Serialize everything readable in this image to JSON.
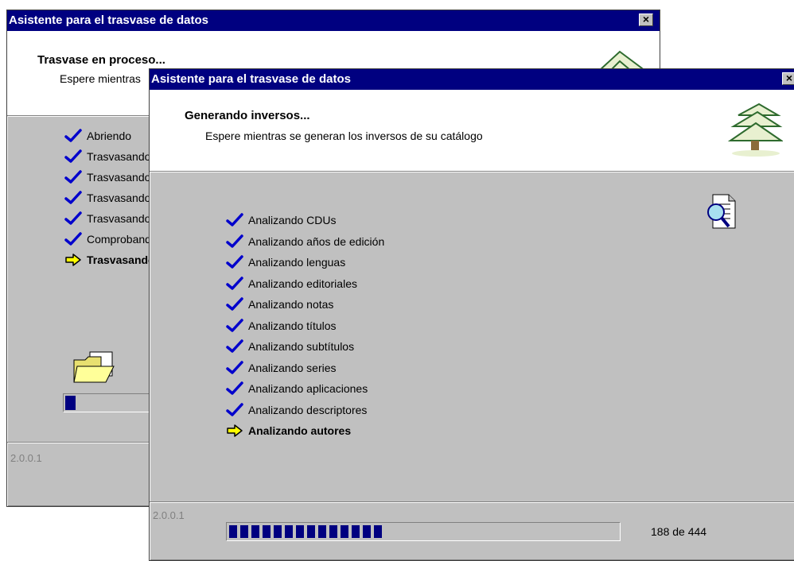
{
  "back_window": {
    "title": "Asistente para el trasvase de datos",
    "close_label": "×",
    "header_title": "Trasvase en proceso...",
    "header_subtitle": "Espere mientras",
    "steps": [
      {
        "label": "Abriendo",
        "status": "done"
      },
      {
        "label": "Trasvasando",
        "status": "done"
      },
      {
        "label": "Trasvasando",
        "status": "done"
      },
      {
        "label": "Trasvasando",
        "status": "done"
      },
      {
        "label": "Trasvasando",
        "status": "done"
      },
      {
        "label": "Comprobando",
        "status": "done"
      },
      {
        "label": "Trasvasando",
        "status": "current"
      }
    ],
    "version": "2.0.0.1",
    "progress_fraction": 0.05
  },
  "front_window": {
    "title": "Asistente para el trasvase de datos",
    "close_label": "×",
    "header_title": "Generando inversos...",
    "header_subtitle": "Espere mientras se generan los inversos de su catálogo",
    "steps": [
      {
        "label": "Analizando CDUs",
        "status": "done"
      },
      {
        "label": "Analizando años de edición",
        "status": "done"
      },
      {
        "label": "Analizando lenguas",
        "status": "done"
      },
      {
        "label": "Analizando editoriales",
        "status": "done"
      },
      {
        "label": "Analizando notas",
        "status": "done"
      },
      {
        "label": "Analizando títulos",
        "status": "done"
      },
      {
        "label": "Analizando subtítulos",
        "status": "done"
      },
      {
        "label": "Analizando series",
        "status": "done"
      },
      {
        "label": "Analizando aplicaciones",
        "status": "done"
      },
      {
        "label": "Analizando descriptores",
        "status": "done"
      },
      {
        "label": "Analizando autores",
        "status": "current"
      }
    ],
    "version": "2.0.0.1",
    "progress": {
      "current": 188,
      "total": 444,
      "text": "188 de 444"
    }
  },
  "colors": {
    "titlebar": "#000080",
    "check": "#0000cc",
    "arrow": "#ffff00",
    "progress": "#000080"
  },
  "icons": {
    "done": "check-icon",
    "current": "arrow-right-icon",
    "header": "tree-icon",
    "document": "document-search-icon",
    "folder": "open-folder-icon"
  }
}
